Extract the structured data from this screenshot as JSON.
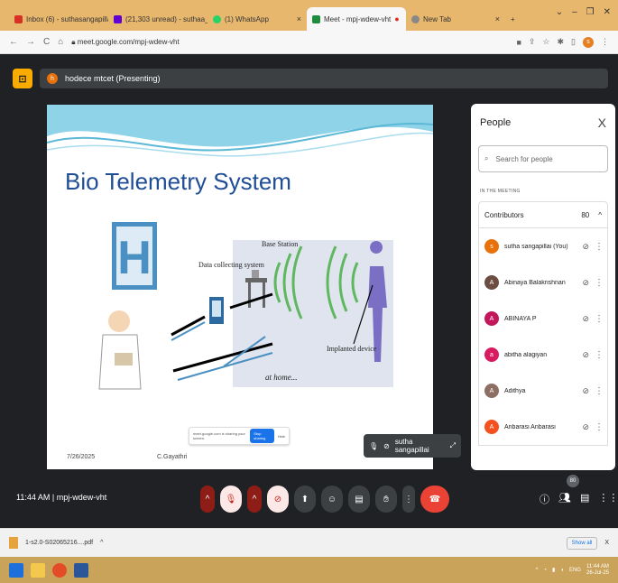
{
  "browser": {
    "tabs": [
      {
        "label": "Inbox (6) - suthasangapillai@gm",
        "color": "#d93025"
      },
      {
        "label": "(21,303 unread) - suthaa_s@yah",
        "color": "#6001d2"
      },
      {
        "label": "(1) WhatsApp",
        "color": "#25d366"
      },
      {
        "label": "Meet - mpj-wdew-vht",
        "color": "#1e8e3e",
        "active": true
      },
      {
        "label": "New Tab",
        "color": "#888888"
      }
    ],
    "new_tab": "+",
    "url": "meet.google.com/mpj-wdew-vht",
    "profile_initial": "s"
  },
  "meet": {
    "presenter": "hodece mtcet (Presenting)",
    "presenter_initial": "h",
    "self_name": "sutha sangapillai",
    "clock": "11:44 AM",
    "separator": "|",
    "meeting_code": "mpj-wdew-vht",
    "participant_badge": "80"
  },
  "slide": {
    "title": "Bio Telemetry System",
    "labels": {
      "data_collecting": "Data collecting system",
      "base_station": "Base Station",
      "implanted": "Implanted device",
      "at_home": "at home..."
    },
    "footer_date": "7/26/2025",
    "footer_author": "C.Gayathri",
    "share_notice": "meet.google.com is sharing your screen.",
    "stop_sharing": "Stop sharing",
    "hide": "Hide"
  },
  "people": {
    "title": "People",
    "close": "X",
    "search_placeholder": "Search for people",
    "section": "IN THE MEETING",
    "contributors_label": "Contributors",
    "contributors_count": "80",
    "list": [
      {
        "name": "sutha sangapillai (You)",
        "initial": "s",
        "color": "#e8710a"
      },
      {
        "name": "Abinaya Balakrishnan",
        "initial": "A",
        "color": "#6d4c41"
      },
      {
        "name": "ABINAYA P",
        "initial": "A",
        "color": "#c2185b"
      },
      {
        "name": "abitha alagiyan",
        "initial": "a",
        "color": "#d81b60"
      },
      {
        "name": "Adithya",
        "initial": "A",
        "color": "#8d6e63"
      },
      {
        "name": "Anbarasi Anbarasi",
        "initial": "A",
        "color": "#f4511e"
      }
    ]
  },
  "downloads": {
    "file": "1-s2.0-S02065216....pdf",
    "show_all": "Show all",
    "close": "X"
  },
  "taskbar": {
    "lang": "ENG",
    "time": "11:44 AM",
    "date": "26-Jul-25"
  }
}
